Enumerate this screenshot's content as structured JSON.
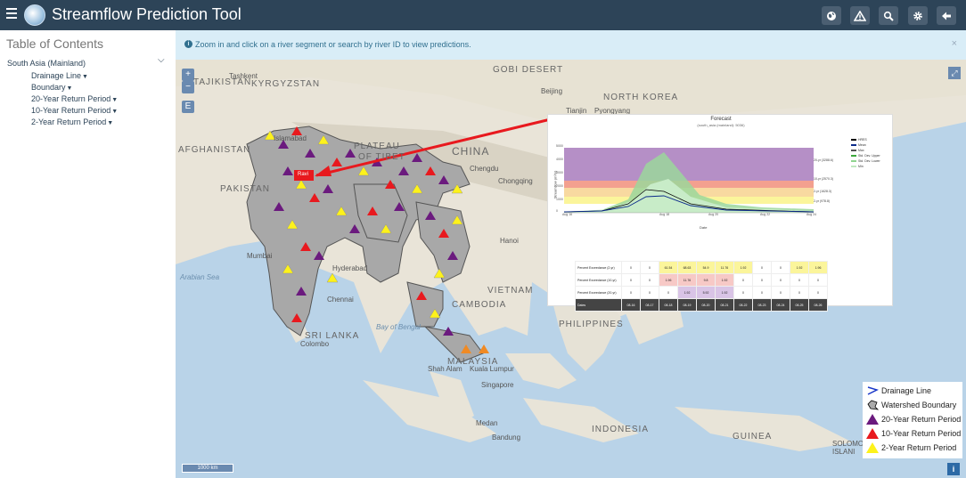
{
  "header": {
    "title": "Streamflow Prediction Tool",
    "icons": [
      "hamburger-icon",
      "globe-icon",
      "warning-icon",
      "search-icon",
      "gear-icon",
      "back-arrow-icon"
    ],
    "bg_color": "#2d4458"
  },
  "sidebar": {
    "title": "Table of Contents",
    "region": "South Asia (Mainland)",
    "items": [
      {
        "label": "Drainage Line"
      },
      {
        "label": "Boundary"
      },
      {
        "label": "20-Year Return Period"
      },
      {
        "label": "10-Year Return Period"
      },
      {
        "label": "2-Year Return Period"
      }
    ]
  },
  "infobar": {
    "text": "Zoom in and click on a river segment or search by river ID to view predictions.",
    "close": "×"
  },
  "map": {
    "zoom_in": "+",
    "zoom_out": "−",
    "extent_button": "E",
    "scale": "1000 km",
    "marker_label": "Ravi",
    "labels": {
      "gobi": "GOBI DESERT",
      "tajikistan": "TAJIKISTAN",
      "tashkent": "Tashkent",
      "kyrgyzstan": "KYRGYZSTAN",
      "afghanistan": "AFGHANISTAN",
      "islamabad": "Islamabad",
      "pakistan": "PAKISTAN",
      "plateau": "PLATEAU",
      "of_tibet": "OF TIBET",
      "china": "CHINA",
      "chengdu": "Chengdu",
      "chongqing": "Chongqing",
      "beijing": "Beijing",
      "tianjin": "Tianjin",
      "pyongyang": "Pyongyang",
      "north_korea": "NORTH KOREA",
      "mumbai": "Mumbai",
      "hyderabad": "Hyderabad",
      "chennai": "Chennai",
      "arabian_sea": "Arabian Sea",
      "bay_of_bengal": "Bay of Bengal",
      "sri_lanka": "SRI LANKA",
      "colombo": "Colombo",
      "hanoi": "Hanoi",
      "vietnam": "VIETNAM",
      "cambodia": "CAMBODIA",
      "philippines": "PHILIPPINES",
      "malaysia": "MALAYSIA",
      "kuala_lumpur": "Kuala Lumpur",
      "shah_alam": "Shah Alam",
      "singapore": "Singapore",
      "indonesia": "INDONESIA",
      "guinea": "GUINEA",
      "solomon": "SOLOMO",
      "islands": "ISLANI",
      "bandung": "Bandung",
      "medan": "Medan"
    }
  },
  "legend": {
    "items": [
      {
        "label": "Drainage Line",
        "icon": "drainage-line-icon"
      },
      {
        "label": "Watershed Boundary",
        "icon": "watershed-boundary-icon"
      },
      {
        "label": "20-Year Return Period",
        "icon": "purple-triangle-icon",
        "color": "#6b1a7e"
      },
      {
        "label": "10-Year Return Period",
        "icon": "red-triangle-icon",
        "color": "#e8191e"
      },
      {
        "label": "2-Year Return Period",
        "icon": "yellow-triangle-icon",
        "color": "#fdf21b"
      }
    ]
  },
  "forecast": {
    "title": "Forecast",
    "subtitle": "(south_asia (mainland): 5036)",
    "ylabel": "Streamflow (m³/s)",
    "xlabel": "Date",
    "yticks": [
      "5000",
      "4000",
      "3000",
      "2000",
      "1000",
      "0"
    ],
    "xticks": [
      "Aug 16",
      "Aug 18",
      "Aug 20",
      "Aug 22",
      "Aug 24"
    ],
    "return_periods": [
      "20-yr (3288.6)",
      "10-yr (2570.3)",
      "2-yr (1628.3)",
      "2-yr (978.8)"
    ],
    "series": [
      {
        "name": "HRES",
        "color": "#000000"
      },
      {
        "name": "Mean",
        "color": "#0b2a8a"
      },
      {
        "name": "Max",
        "color": "#555555"
      },
      {
        "name": "Std. Dev. Upper",
        "color": "#3da83d"
      },
      {
        "name": "Std. Dev. Lower",
        "color": "#8fd48f"
      },
      {
        "name": "Min",
        "color": "#bfe8bf"
      }
    ],
    "table": {
      "rows": [
        {
          "label": "Percent Exceedance (2-yr)",
          "cells": [
            "0",
            "0",
            "61.54",
            "68.63",
            "54.9",
            "11.76",
            "1.92",
            "0",
            "0",
            "1.92",
            "1.96"
          ]
        },
        {
          "label": "Percent Exceedance (10-yr)",
          "cells": [
            "0",
            "0",
            "1.96",
            "11.76",
            "9.8",
            "1.92",
            "0",
            "0",
            "0",
            "0",
            "0"
          ]
        },
        {
          "label": "Percent Exceedance (20-yr)",
          "cells": [
            "0",
            "0",
            "0",
            "1.92",
            "5.92",
            "1.92",
            "0",
            "0",
            "0",
            "0",
            "0"
          ]
        }
      ],
      "dates_label": "Dates",
      "dates": [
        "08-16",
        "08-17",
        "08-18",
        "08-19",
        "08-20",
        "08-21",
        "08-22",
        "08-23",
        "08-24",
        "08-25",
        "08-26"
      ]
    }
  }
}
